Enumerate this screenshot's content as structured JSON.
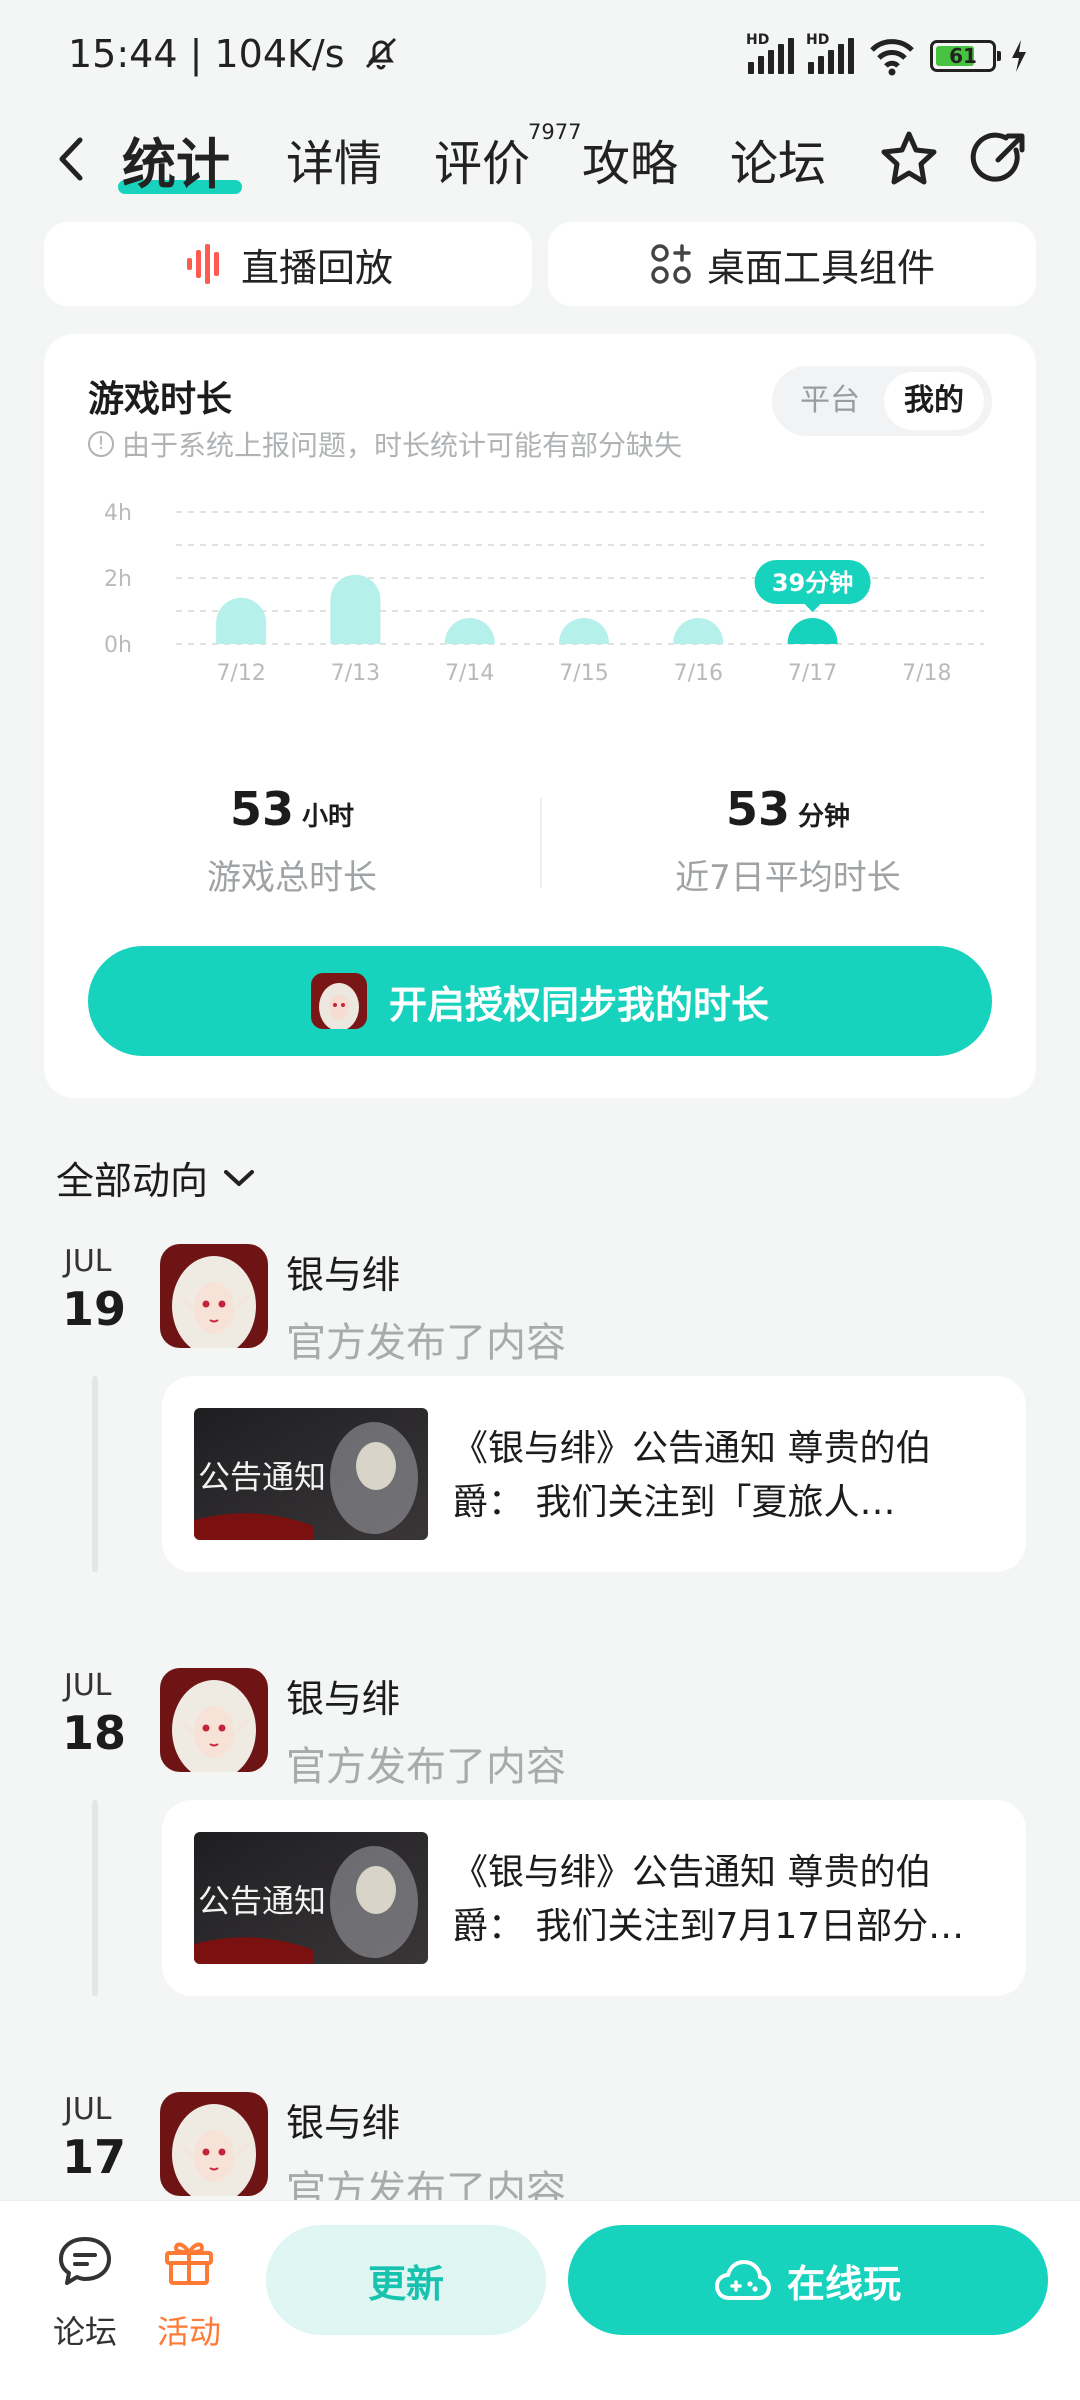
{
  "status": {
    "time": "15:44",
    "speed": "104K/s",
    "network": "HD",
    "battery": "61"
  },
  "nav": {
    "tabs": [
      "统计",
      "详情",
      "评价",
      "攻略",
      "论坛"
    ],
    "review_count": "7977"
  },
  "quick": {
    "replay": "直播回放",
    "widget": "桌面工具组件"
  },
  "stats": {
    "title": "游戏时长",
    "note": "由于系统上报问题，时长统计可能有部分缺失",
    "toggle": {
      "platform": "平台",
      "mine": "我的"
    },
    "total_value": "53",
    "total_unit": "小时",
    "total_label": "游戏总时长",
    "avg_value": "53",
    "avg_unit": "分钟",
    "avg_label": "近7日平均时长",
    "sync_label": "开启授权同步我的时长"
  },
  "chart_data": {
    "type": "bar",
    "categories": [
      "7/12",
      "7/13",
      "7/14",
      "7/15",
      "7/16",
      "7/17",
      "7/18"
    ],
    "values": [
      1.4,
      2.1,
      0.65,
      0.75,
      0.7,
      0.65,
      0
    ],
    "y_ticks": [
      "0h",
      "2h",
      "4h"
    ],
    "ylim": [
      0,
      4
    ],
    "grid": true,
    "highlight_index": 5,
    "highlight_label": "39分钟",
    "colors": {
      "bar": "#b6f0ea",
      "highlight": "#17d2bd"
    }
  },
  "feed": {
    "filter": "全部动向",
    "items": [
      {
        "month": "JUL",
        "day": "19",
        "game": "银与绯",
        "action": "官方发布了内容",
        "thumb_text": "公告通知",
        "text": "《银与绯》公告通知 尊贵的伯爵：   我们关注到「夏旅人…"
      },
      {
        "month": "JUL",
        "day": "18",
        "game": "银与绯",
        "action": "官方发布了内容",
        "thumb_text": "公告通知",
        "text": "《银与绯》公告通知 尊贵的伯爵：  我们关注到7月17日部分…"
      },
      {
        "month": "JUL",
        "day": "17",
        "game": "银与绯",
        "action": "官方发布了内容"
      }
    ]
  },
  "bottom": {
    "forum": "论坛",
    "events": "活动",
    "update": "更新",
    "play": "在线玩"
  },
  "colors": {
    "accent": "#17d2bd",
    "events": "#ff7a35"
  }
}
